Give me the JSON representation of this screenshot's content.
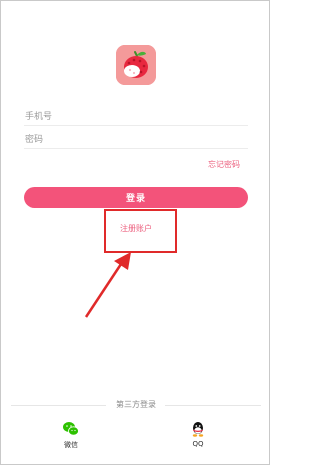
{
  "form": {
    "phone_placeholder": "手机号",
    "password_placeholder": "密码",
    "forgot_password": "忘记密码",
    "login_button": "登录",
    "register_link": "注册账户"
  },
  "third_party": {
    "title": "第三方登录",
    "items": [
      {
        "label": "微信",
        "icon": "wechat-icon"
      },
      {
        "label": "QQ",
        "icon": "qq-icon"
      }
    ]
  },
  "colors": {
    "accent": "#f3537a",
    "highlight_box": "#e02a2a",
    "wechat": "#2dc100"
  }
}
